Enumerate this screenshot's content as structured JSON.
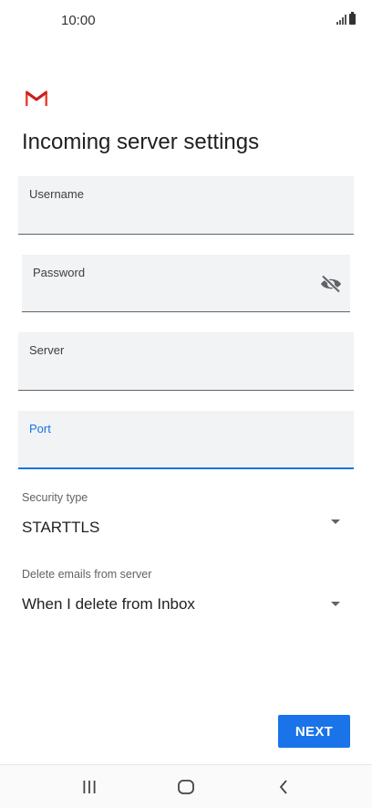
{
  "status_bar": {
    "time": "10:00",
    "icons": [
      "signal-icon",
      "battery-icon"
    ]
  },
  "app": {
    "logo": "gmail-logo",
    "brand_colors": [
      "#ea4335",
      "#c5221f"
    ]
  },
  "page": {
    "title": "Incoming server settings"
  },
  "fields": {
    "username": {
      "label": "Username",
      "value": ""
    },
    "password": {
      "label": "Password",
      "value": "",
      "toggle_icon": "eye-off-icon"
    },
    "server": {
      "label": "Server",
      "value": ""
    },
    "port": {
      "label": "Port",
      "value": "",
      "focused": true
    }
  },
  "security_type": {
    "label": "Security type",
    "value": "STARTTLS"
  },
  "delete_emails": {
    "label": "Delete emails from server",
    "value": "When I delete from Inbox"
  },
  "actions": {
    "next_label": "NEXT"
  },
  "nav_bar": {
    "icons": [
      "recent-apps-icon",
      "home-icon",
      "back-icon"
    ]
  },
  "colors": {
    "accent": "#1a73e8",
    "field_background": "#f1f3f4"
  }
}
